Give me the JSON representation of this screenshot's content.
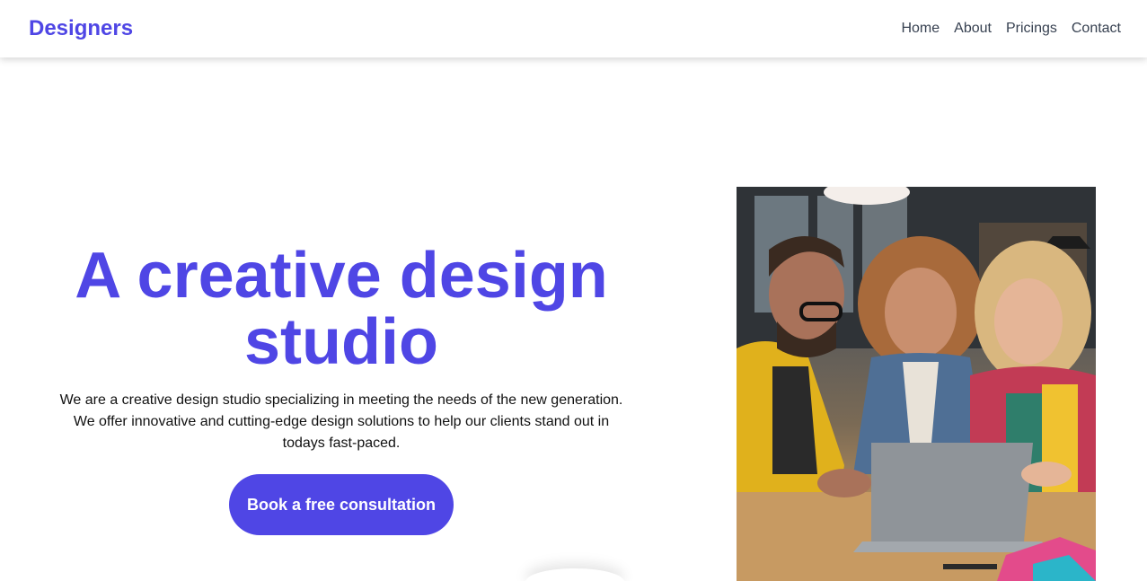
{
  "header": {
    "brand": "Designers",
    "nav": [
      "Home",
      "About",
      "Pricings",
      "Contact"
    ]
  },
  "hero": {
    "title": "A creative design studio",
    "description": "We are a creative design studio specializing in meeting the needs of the new generation. We offer innovative and cutting-edge design solutions to help our clients stand out in todays fast-paced.",
    "cta_label": "Book a free consultation"
  },
  "colors": {
    "accent": "#4f46e5",
    "nav_text": "#374151"
  }
}
